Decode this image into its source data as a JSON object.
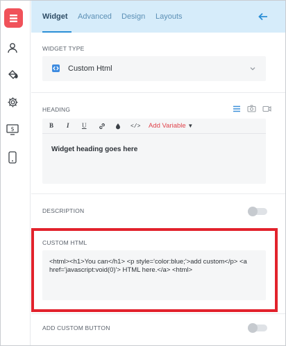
{
  "rail": {
    "items": [
      {
        "name": "widget-icon",
        "active": true
      },
      {
        "name": "user-icon",
        "active": false
      },
      {
        "name": "paint-bucket-icon",
        "active": false
      },
      {
        "name": "gear-icon",
        "active": false
      },
      {
        "name": "dollar-screen-icon",
        "active": false
      },
      {
        "name": "mobile-icon",
        "active": false
      }
    ],
    "accent": "#f0525a"
  },
  "tabs": {
    "items": [
      "Widget",
      "Advanced",
      "Design",
      "Layouts"
    ],
    "active": "Widget",
    "back_icon": "arrow-left-icon"
  },
  "widget_type": {
    "label": "WIDGET TYPE",
    "value": "Custom Html",
    "icon": "code-icon"
  },
  "heading": {
    "label": "HEADING",
    "toolbar": [
      "B",
      "I",
      "U",
      "link",
      "color",
      "</>",
      "Add Variable"
    ],
    "add_variable": "Add Variable",
    "text": "Widget heading goes here",
    "tools": [
      "align-icon",
      "camera-icon",
      "video-icon"
    ]
  },
  "description": {
    "label": "DESCRIPTION",
    "enabled": false
  },
  "custom_html": {
    "label": "CUSTOM HTML",
    "value": "<html><h1>You can</h1> <p style='color:blue;'>add custom</p> <a href='javascript:void(0)'> HTML here.</a> <html>"
  },
  "custom_button": {
    "label": "ADD CUSTOM BUTTON",
    "enabled": false
  },
  "colors": {
    "header_bg": "#d6ecfa",
    "highlight": "#e2222c",
    "link_blue": "#2b8fd6"
  }
}
